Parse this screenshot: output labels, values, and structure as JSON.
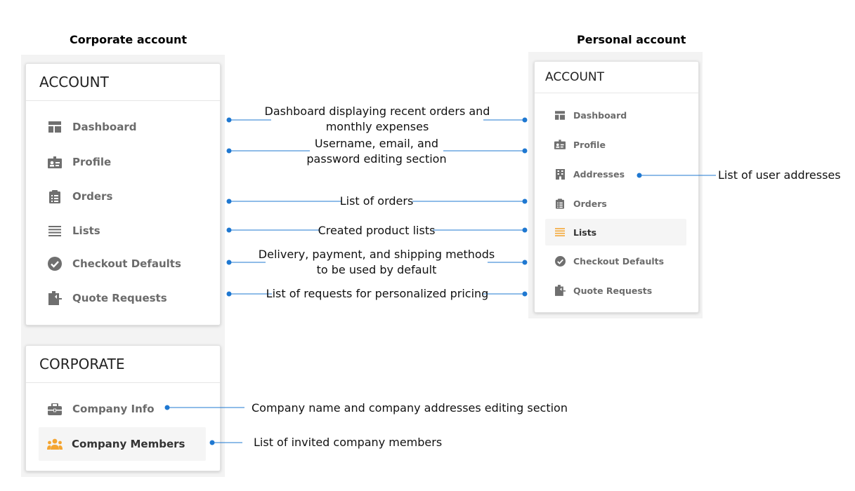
{
  "corporate_heading": "Corporate account",
  "personal_heading": "Personal account",
  "corporate_account_panel": {
    "title": "ACCOUNT",
    "items": [
      {
        "label": "Dashboard",
        "icon": "dashboard-icon"
      },
      {
        "label": "Profile",
        "icon": "profile-card-icon"
      },
      {
        "label": "Orders",
        "icon": "clipboard-icon"
      },
      {
        "label": "Lists",
        "icon": "lines-icon"
      },
      {
        "label": "Checkout Defaults",
        "icon": "check-circle-icon"
      },
      {
        "label": "Quote Requests",
        "icon": "quote-request-icon"
      }
    ]
  },
  "corporate_panel": {
    "title": "CORPORATE",
    "items": [
      {
        "label": "Company Info",
        "icon": "briefcase-icon"
      },
      {
        "label": "Company Members",
        "icon": "people-icon",
        "active": true
      }
    ]
  },
  "personal_account_panel": {
    "title": "ACCOUNT",
    "items": [
      {
        "label": "Dashboard",
        "icon": "dashboard-icon"
      },
      {
        "label": "Profile",
        "icon": "profile-card-icon"
      },
      {
        "label": "Addresses",
        "icon": "building-icon"
      },
      {
        "label": "Orders",
        "icon": "clipboard-icon"
      },
      {
        "label": "Lists",
        "icon": "lines-icon",
        "active": true
      },
      {
        "label": "Checkout Defaults",
        "icon": "check-circle-icon"
      },
      {
        "label": "Quote Requests",
        "icon": "quote-request-icon"
      }
    ]
  },
  "annotations": {
    "dashboard_line1": "Dashboard displaying recent orders and",
    "dashboard_line2": "monthly expenses",
    "profile_line1": "Username, email, and",
    "profile_line2": "password editing section",
    "orders": "List of orders",
    "lists": "Created product lists",
    "checkout_line1": "Delivery, payment, and shipping methods",
    "checkout_line2": "to be used by default",
    "quotes": "List of requests for personalized pricing",
    "addresses": "List of user addresses",
    "company_info": "Company name and company addresses editing section",
    "company_members": "List of invited company members"
  },
  "colors": {
    "connector": "#1f78d1",
    "active_icon": "#f4a532",
    "icon": "#6f6f6f"
  }
}
